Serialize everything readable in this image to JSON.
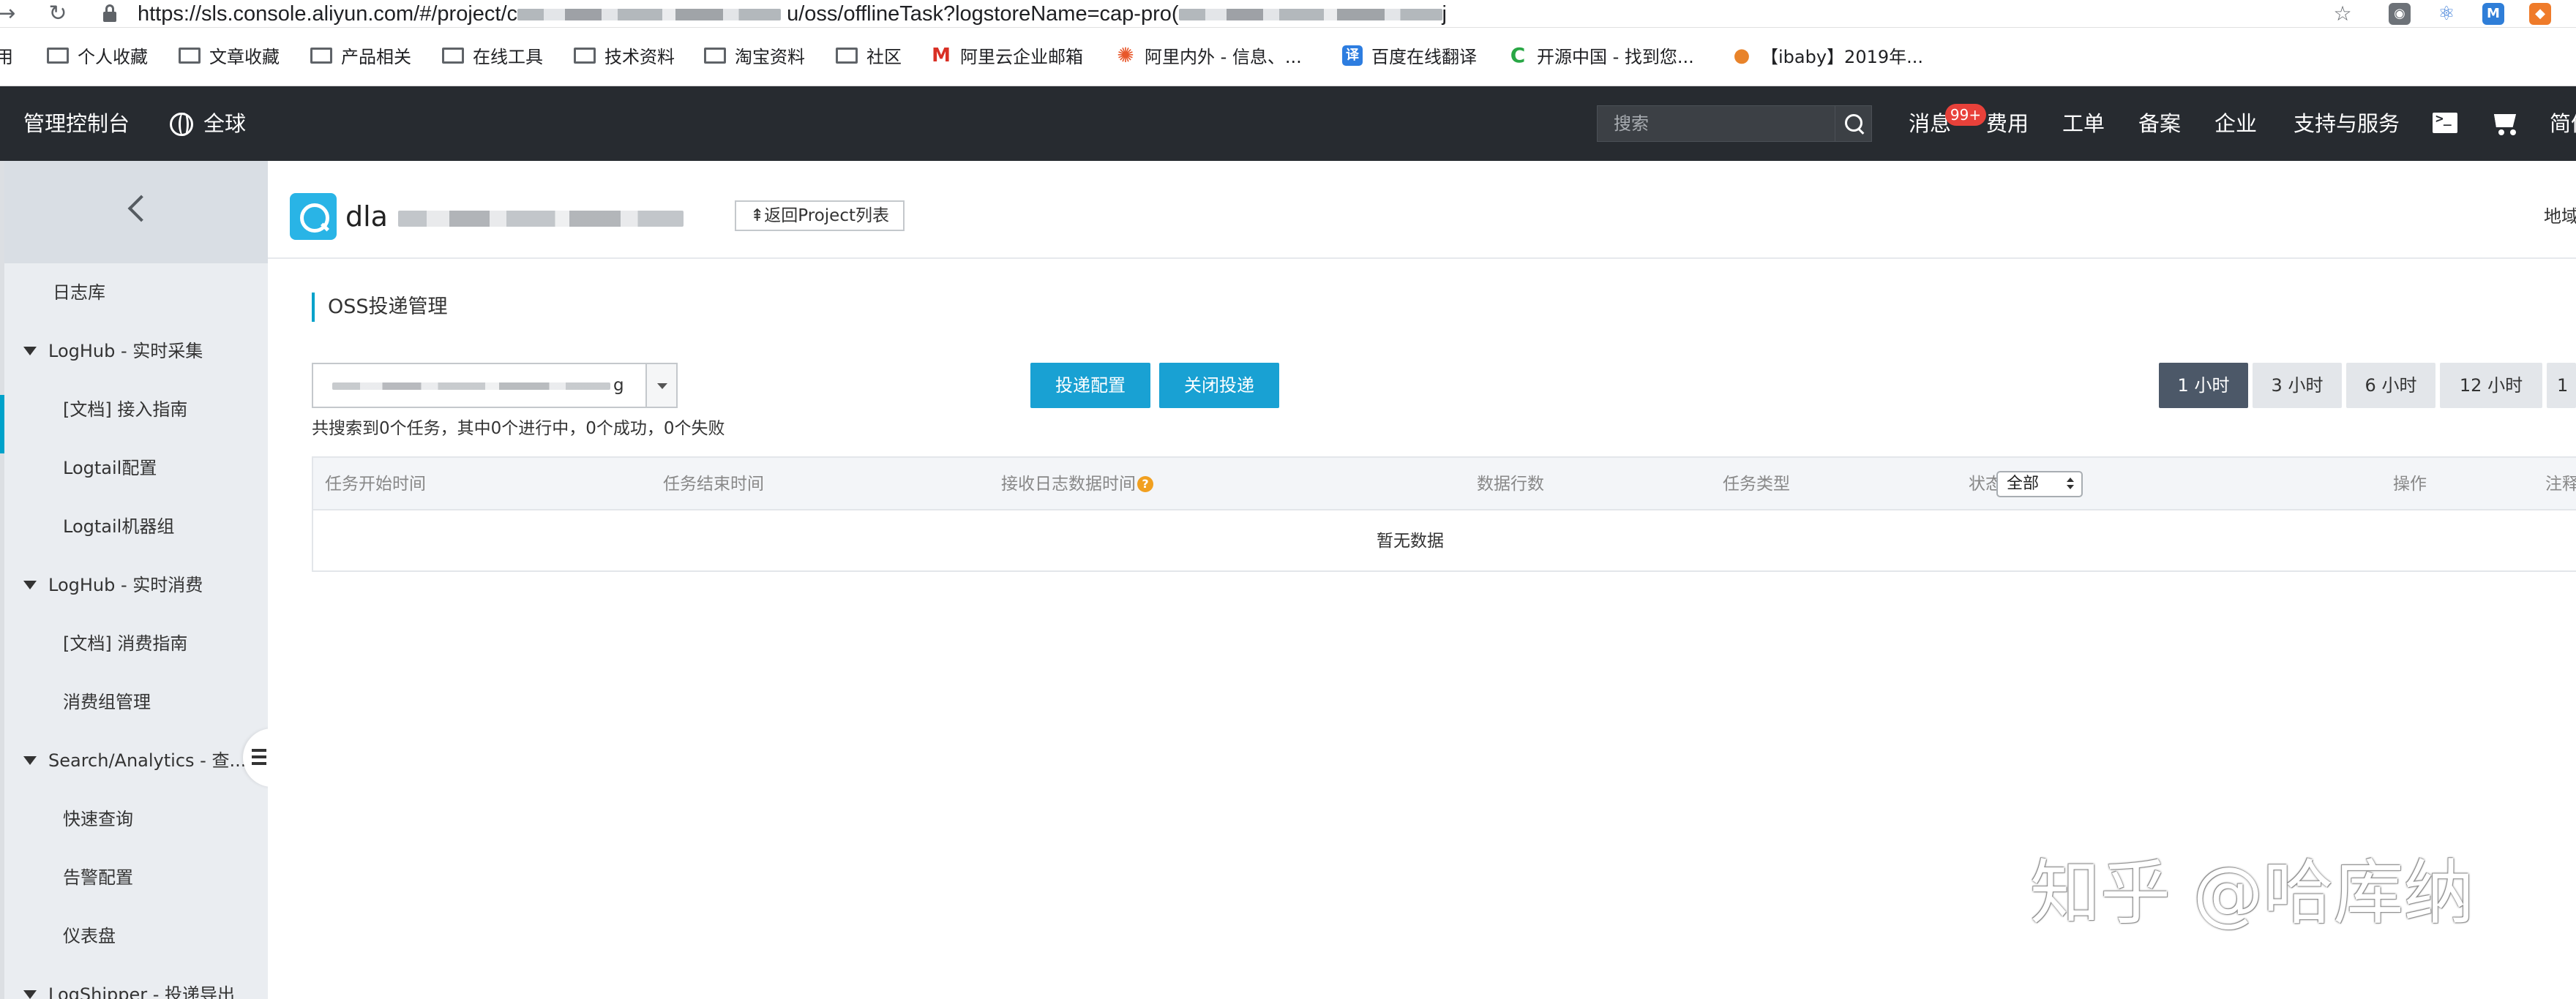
{
  "browser": {
    "url_prefix": "https://sls.console.aliyun.com/#/project/c",
    "url_middle": "u/oss/offlineTask?logstoreName=cap-pro(",
    "url_suffix": "j",
    "bookmarks": [
      "个人收藏",
      "文章收藏",
      "产品相关",
      "在线工具",
      "技术资料",
      "淘宝资料",
      "社区",
      "阿里云企业邮箱",
      "阿里内外 - 信息、...",
      "百度在线翻译",
      "开源中国 - 找到您...",
      "【ibaby】2019年..."
    ],
    "bookmark_cut": "用",
    "extension_m": "M"
  },
  "topbar": {
    "console_title": "管理控制台",
    "region": "全球",
    "search_placeholder": "搜索",
    "messages": "消息",
    "badge": "99+",
    "nav": [
      "费用",
      "工单",
      "备案",
      "企业",
      "支持与服务"
    ],
    "lang": "简体"
  },
  "sidebar": {
    "items": [
      {
        "label": "日志库",
        "kind": "top"
      },
      {
        "label": "LogHub - 实时采集",
        "kind": "group"
      },
      {
        "label": "[文档] 接入指南",
        "kind": "leaf"
      },
      {
        "label": "Logtail配置",
        "kind": "leaf"
      },
      {
        "label": "Logtail机器组",
        "kind": "leaf"
      },
      {
        "label": "LogHub - 实时消费",
        "kind": "group"
      },
      {
        "label": "[文档] 消费指南",
        "kind": "leaf"
      },
      {
        "label": "消费组管理",
        "kind": "leaf"
      },
      {
        "label": "Search/Analytics - 查...",
        "kind": "group"
      },
      {
        "label": "快速查询",
        "kind": "leaf"
      },
      {
        "label": "告警配置",
        "kind": "leaf"
      },
      {
        "label": "仪表盘",
        "kind": "leaf"
      },
      {
        "label": "LogShipper - 投递导出",
        "kind": "group"
      }
    ]
  },
  "project": {
    "name_prefix": "dla",
    "back_button": "⇞返回Project列表",
    "region_label": "地域"
  },
  "section": {
    "title": "OSS投递管理",
    "logstore_suffix": "g",
    "summary": "共搜索到0个任务，其中0个进行中，0个成功，0个失败",
    "buttons": {
      "config": "投递配置",
      "close": "关闭投递"
    },
    "time_ranges": [
      "1 小时",
      "3 小时",
      "6 小时",
      "12 小时",
      "1"
    ],
    "selected_time_range": "1 小时"
  },
  "table": {
    "columns": [
      "任务开始时间",
      "任务结束时间",
      "接收日志数据时间",
      "数据行数",
      "任务类型",
      "状态",
      "操作",
      "注释"
    ],
    "status_filter": "全部",
    "help_mark": "?",
    "empty_text": "暂无数据"
  },
  "watermark": "知乎 @哈库纳",
  "colors": {
    "topbar_bg": "#272b30",
    "accent": "#00a2ca",
    "primary_button": "#19a1d3",
    "active_time": "#4c5868",
    "badge": "#e8413a"
  }
}
